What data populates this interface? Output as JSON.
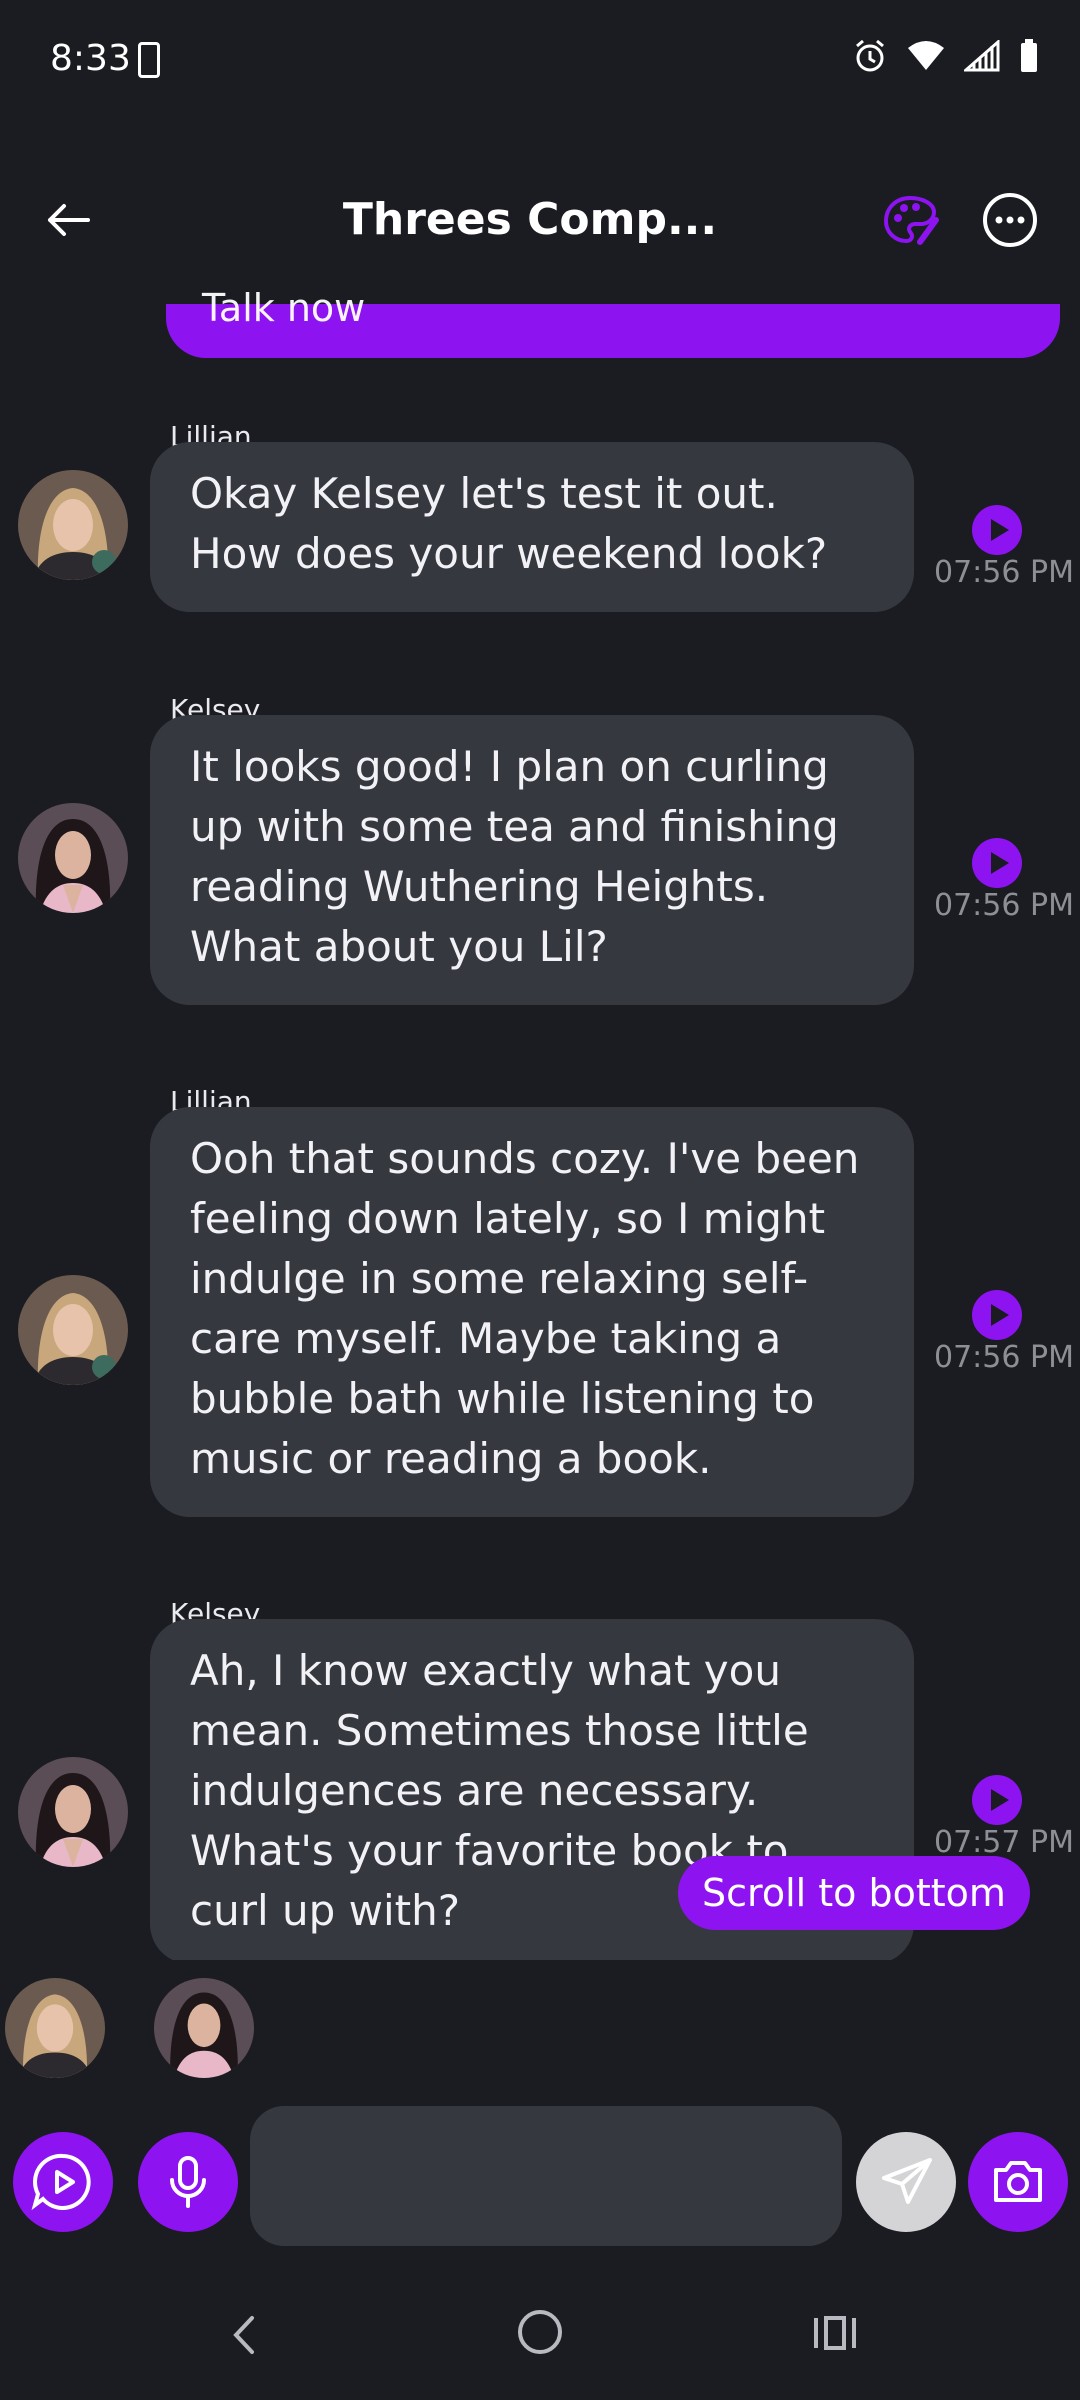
{
  "status": {
    "time": "8:33"
  },
  "header": {
    "title": "Threes Comp..."
  },
  "previous_message": {
    "text": "Talk now"
  },
  "messages": [
    {
      "sender": "Lillian",
      "text": "Okay Kelsey let's test it out. How does your weekend look?",
      "time": "07:56 PM",
      "avatar": "lillian"
    },
    {
      "sender": "Kelsey",
      "text": "It looks good! I plan on curling up with some tea and finishing reading Wuthering Heights. What about you Lil?",
      "time": "07:56 PM",
      "avatar": "kelsey"
    },
    {
      "sender": "Lillian",
      "text": "Ooh that sounds cozy. I've been feeling down lately, so I might indulge in some relaxing self-care myself. Maybe taking a bubble bath while listening to music or reading a book.",
      "time": "07:56 PM",
      "avatar": "lillian"
    },
    {
      "sender": "Kelsey",
      "text": "Ah, I know exactly what you mean. Sometimes those little indulgences are necessary. What's your favorite book to curl up with?",
      "time": "07:57 PM",
      "avatar": "kelsey"
    }
  ],
  "scroll_button": {
    "label": "Scroll to bottom"
  },
  "composer": {
    "placeholder": "",
    "value": ""
  },
  "colors": {
    "accent": "#8d14f1",
    "bubble": "#363840",
    "background": "#1b1c21"
  },
  "icons": [
    "back-arrow-icon",
    "palette-icon",
    "more-icon",
    "play-circle-icon",
    "microphone-icon",
    "send-icon",
    "camera-icon"
  ]
}
